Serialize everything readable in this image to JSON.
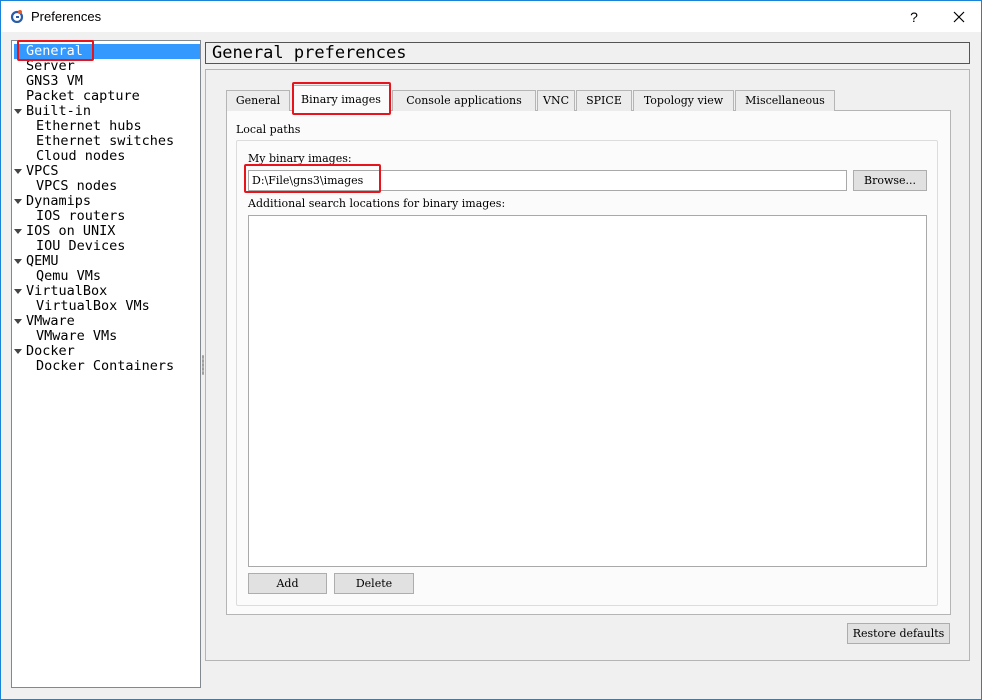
{
  "window": {
    "title": "Preferences",
    "help_label": "?",
    "border_color": "#1883d7"
  },
  "sidebar": {
    "items": [
      {
        "label": "General",
        "level": 0,
        "selected": true
      },
      {
        "label": "Server",
        "level": 0
      },
      {
        "label": "GNS3 VM",
        "level": 0
      },
      {
        "label": "Packet capture",
        "level": 0
      },
      {
        "label": "Built-in",
        "level": 0,
        "expanded": true
      },
      {
        "label": "Ethernet hubs",
        "level": 1
      },
      {
        "label": "Ethernet switches",
        "level": 1
      },
      {
        "label": "Cloud nodes",
        "level": 1
      },
      {
        "label": "VPCS",
        "level": 0,
        "expanded": true
      },
      {
        "label": "VPCS nodes",
        "level": 1
      },
      {
        "label": "Dynamips",
        "level": 0,
        "expanded": true
      },
      {
        "label": "IOS routers",
        "level": 1
      },
      {
        "label": "IOS on UNIX",
        "level": 0,
        "expanded": true
      },
      {
        "label": "IOU Devices",
        "level": 1
      },
      {
        "label": "QEMU",
        "level": 0,
        "expanded": true
      },
      {
        "label": "Qemu VMs",
        "level": 1
      },
      {
        "label": "VirtualBox",
        "level": 0,
        "expanded": true
      },
      {
        "label": "VirtualBox VMs",
        "level": 1
      },
      {
        "label": "VMware",
        "level": 0,
        "expanded": true
      },
      {
        "label": "VMware VMs",
        "level": 1
      },
      {
        "label": "Docker",
        "level": 0,
        "expanded": true
      },
      {
        "label": "Docker Containers",
        "level": 1
      }
    ],
    "selected_color": "#3399ff"
  },
  "main": {
    "header": "General preferences",
    "tabs": [
      {
        "label": "General"
      },
      {
        "label": "Binary images",
        "active": true
      },
      {
        "label": "Console applications"
      },
      {
        "label": "VNC"
      },
      {
        "label": "SPICE"
      },
      {
        "label": "Topology view"
      },
      {
        "label": "Miscellaneous"
      }
    ],
    "group_title": "Local paths",
    "binary_images_label": "My binary images:",
    "binary_images_path": "D:\\File\\gns3\\images",
    "browse_label": "Browse...",
    "additional_label": "Additional search locations for binary images:",
    "add_label": "Add",
    "delete_label": "Delete",
    "restore_label": "Restore defaults"
  },
  "highlight_color": "#e8141b"
}
